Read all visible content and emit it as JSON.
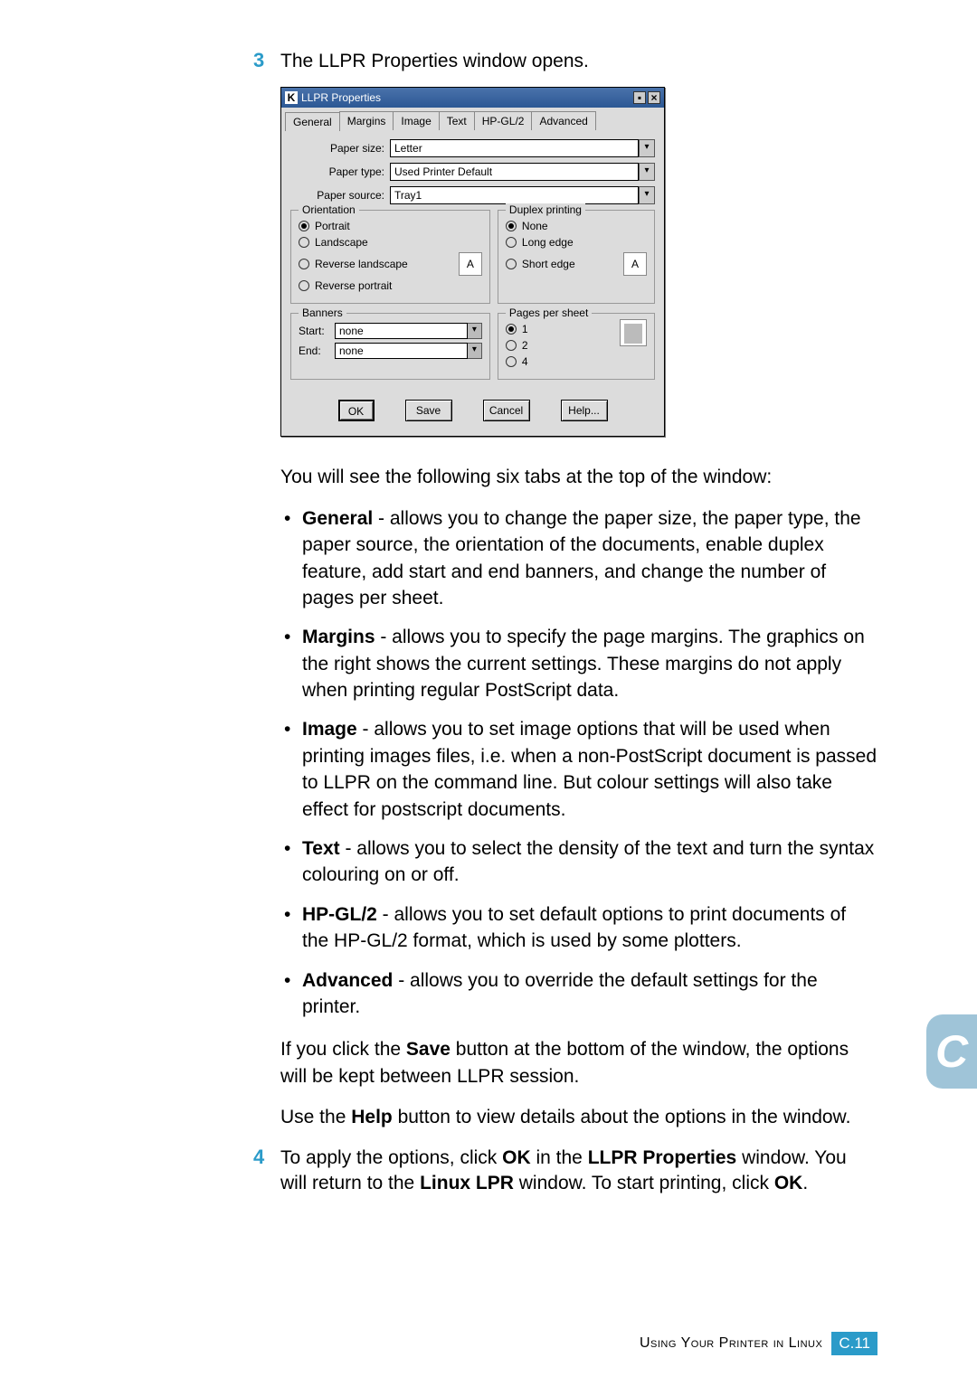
{
  "step3": {
    "num": "3",
    "text": "The LLPR Properties window opens."
  },
  "screenshot": {
    "window_title": "LLPR Properties",
    "tabs": [
      "General",
      "Margins",
      "Image",
      "Text",
      "HP-GL/2",
      "Advanced"
    ],
    "paper_size_label": "Paper size:",
    "paper_size": "Letter",
    "paper_type_label": "Paper type:",
    "paper_type": "Used Printer Default",
    "paper_source_label": "Paper source:",
    "paper_source": "Tray1",
    "orientation_label": "Orientation",
    "orientation_opts": [
      "Portrait",
      "Landscape",
      "Reverse landscape",
      "Reverse portrait"
    ],
    "orient_preview": "A",
    "duplex_label": "Duplex printing",
    "duplex_opts": [
      "None",
      "Long edge",
      "Short edge"
    ],
    "duplex_preview": "A",
    "banners_label": "Banners",
    "banners_start_label": "Start:",
    "banners_start": "none",
    "banners_end_label": "End:",
    "banners_end": "none",
    "pps_label": "Pages per sheet",
    "pps_opts": [
      "1",
      "2",
      "4"
    ],
    "btn_ok": "OK",
    "btn_save": "Save",
    "btn_cancel": "Cancel",
    "btn_help": "Help..."
  },
  "intro_after": "You will see the following six tabs at the top of the window:",
  "tabs_desc": [
    {
      "name": "General",
      "rest": " - allows you to change the paper size, the paper type, the paper source, the orientation of the documents, enable duplex feature, add start and end banners, and change the number of pages per sheet."
    },
    {
      "name": "Margins",
      "rest": " - allows you to specify the page margins. The graphics on the right shows the current settings. These margins do not apply when printing regular PostScript data."
    },
    {
      "name": "Image",
      "rest": " - allows you to set image options that will be used when printing images files, i.e. when a non-PostScript document is passed to LLPR on the command line. But colour settings will also take effect for postscript documents."
    },
    {
      "name": "Text",
      "rest": " - allows you to select the density of the text and turn the syntax colouring on or off."
    },
    {
      "name": "HP-GL/2",
      "rest": " - allows you to set default options to print documents of the HP-GL/2 format, which is used by some plotters."
    },
    {
      "name": "Advanced",
      "rest": " - allows you to override the default settings for the printer."
    }
  ],
  "save_para_1": "If you click the ",
  "save_bold": "Save",
  "save_para_2": " button at the bottom of the window, the options will be kept between LLPR session.",
  "help_para_1": "Use the ",
  "help_bold": "Help",
  "help_para_2": " button to view details about the options in the window.",
  "step4": {
    "num": "4",
    "p1": "To apply the options, click ",
    "b1": "OK",
    "p2": " in the ",
    "b2": "LLPR Properties",
    "p3": " window. You will return to the ",
    "b3": "Linux LPR",
    "p4": " window. To start printing, click ",
    "b4": "OK",
    "p5": "."
  },
  "side_badge": "C",
  "footer": {
    "label": "Using Your Printer in Linux",
    "page": "C.11"
  }
}
